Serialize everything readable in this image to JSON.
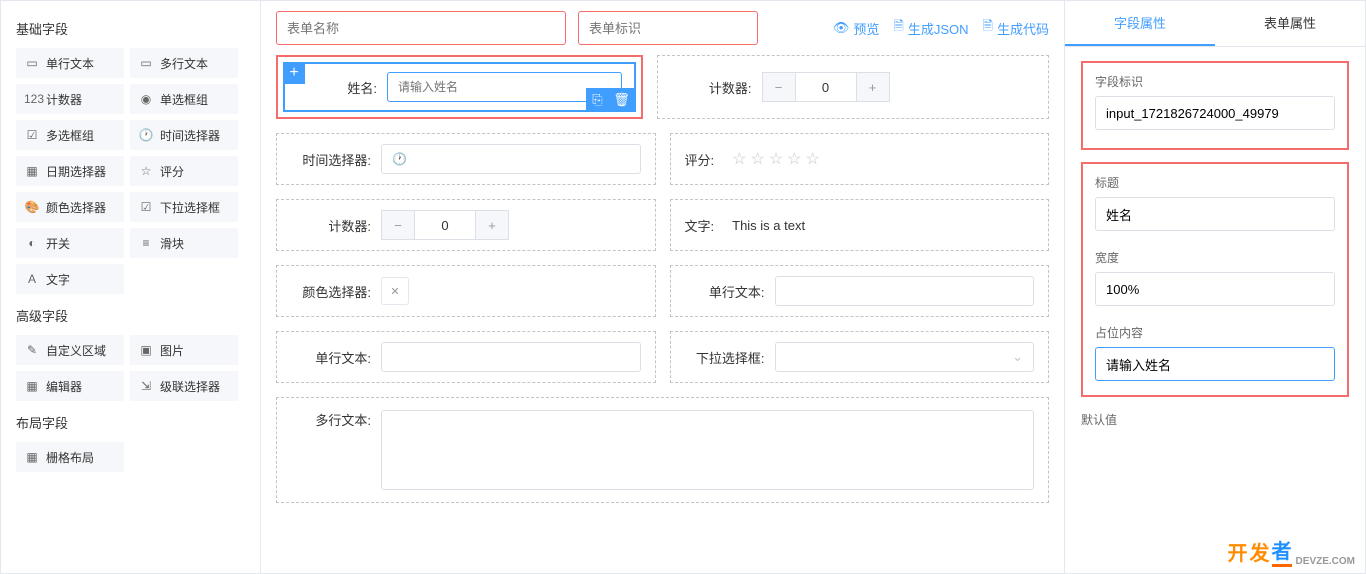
{
  "leftPanel": {
    "sections": {
      "basic": {
        "title": "基础字段",
        "items": [
          {
            "icon": "▭",
            "label": "单行文本"
          },
          {
            "icon": "▭",
            "label": "多行文本"
          },
          {
            "icon": "123",
            "label": "计数器"
          },
          {
            "icon": "◉",
            "label": "单选框组"
          },
          {
            "icon": "☑",
            "label": "多选框组"
          },
          {
            "icon": "🕐",
            "label": "时间选择器"
          },
          {
            "icon": "▦",
            "label": "日期选择器"
          },
          {
            "icon": "☆",
            "label": "评分"
          },
          {
            "icon": "🎨",
            "label": "颜色选择器"
          },
          {
            "icon": "☑",
            "label": "下拉选择框"
          },
          {
            "icon": "◐",
            "label": "开关"
          },
          {
            "icon": "≡",
            "label": "滑块"
          },
          {
            "icon": "A",
            "label": "文字"
          }
        ]
      },
      "advanced": {
        "title": "高级字段",
        "items": [
          {
            "icon": "✎",
            "label": "自定义区域"
          },
          {
            "icon": "▣",
            "label": "图片"
          },
          {
            "icon": "▦",
            "label": "编辑器"
          },
          {
            "icon": "⇲",
            "label": "级联选择器"
          }
        ]
      },
      "layout": {
        "title": "布局字段",
        "items": [
          {
            "icon": "▦",
            "label": "栅格布局"
          }
        ]
      }
    }
  },
  "topBar": {
    "formNamePlaceholder": "表单名称",
    "formIdPlaceholder": "表单标识",
    "preview": "预览",
    "genJson": "生成JSON",
    "genCode": "生成代码"
  },
  "canvas": {
    "row1": {
      "nameLabel": "姓名:",
      "namePlaceholder": "请输入姓名",
      "counterLabel": "计数器:",
      "counterValue": "0"
    },
    "row2": {
      "timeLabel": "时间选择器:",
      "rateLabel": "评分:"
    },
    "row3": {
      "counterLabel": "计数器:",
      "counterValue": "0",
      "textLabel": "文字:",
      "textValue": "This is a text"
    },
    "row4": {
      "colorLabel": "颜色选择器:",
      "inputLabel": "单行文本:"
    },
    "row5": {
      "inputLabel": "单行文本:",
      "selectLabel": "下拉选择框:"
    },
    "row6": {
      "textareaLabel": "多行文本:"
    }
  },
  "rightPanel": {
    "tabs": {
      "field": "字段属性",
      "form": "表单属性"
    },
    "props": {
      "fieldIdLabel": "字段标识",
      "fieldIdValue": "input_1721826724000_49979",
      "titleLabel": "标题",
      "titleValue": "姓名",
      "widthLabel": "宽度",
      "widthValue": "100%",
      "placeholderLabel": "占位内容",
      "placeholderValue": "请输入姓名",
      "defaultLabel": "默认值"
    }
  },
  "watermark": {
    "kai": "开",
    "fa": "发",
    "zhe": "者",
    "domain": "DEVZE.COM"
  }
}
